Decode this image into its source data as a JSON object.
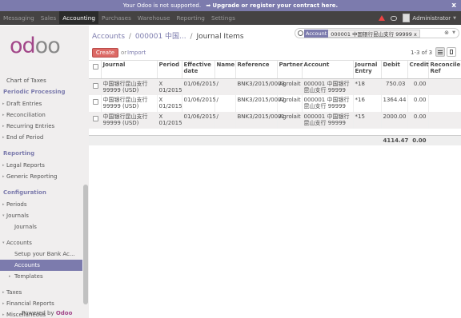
{
  "announcement": {
    "text": "Your Odoo is not supported.",
    "link": "Upgrade or register your contract here.",
    "close": "x"
  },
  "topbar": {
    "menu": [
      "Messaging",
      "Sales",
      "Accounting",
      "Purchases",
      "Warehouse",
      "Reporting",
      "Settings"
    ],
    "active": "Accounting",
    "user": "Administrator"
  },
  "logo": {
    "text_main": "od",
    "text_accent": "oo"
  },
  "sidebar": {
    "top_items": [
      "Chart of Taxes"
    ],
    "periodic": {
      "title": "Periodic Processing",
      "items": [
        "Draft Entries",
        "Reconciliation",
        "Recurring Entries",
        "End of Period"
      ]
    },
    "reporting": {
      "title": "Reporting",
      "items": [
        "Legal Reports",
        "Generic Reporting"
      ]
    },
    "configuration": {
      "title": "Configuration",
      "periods": "Periods",
      "journals": "Journals",
      "journals_sub": "Journals",
      "accounts": "Accounts",
      "setup_bank": "Setup your Bank Ac...",
      "accounts_sub": "Accounts",
      "templates": "Templates",
      "taxes": "Taxes",
      "financial_reports": "Financial Reports",
      "miscellaneous": "Miscellaneous"
    },
    "powered_by": "Powered by",
    "powered_brand": "Odoo"
  },
  "breadcrumb": {
    "root": "Accounts",
    "mid": "000001 中国...",
    "current": "Journal Items"
  },
  "search": {
    "facet_key": "Account",
    "facet_value": "000001 中国银行昆山支行 99999",
    "facet_remove": "x"
  },
  "toolbar": {
    "create": "Create",
    "or": "or",
    "import": "Import",
    "pager": "1-3 of 3"
  },
  "table": {
    "columns": [
      "Journal",
      "Period",
      "Effective date",
      "Name",
      "Reference",
      "Partner",
      "Account",
      "Journal Entry",
      "Debit",
      "Credit",
      "Reconcile Ref"
    ],
    "rows": [
      {
        "journal": "中国银行昆山支行 99999 (USD)",
        "period": "X 01/2015",
        "date": "01/06/2015",
        "name": "/",
        "reference": "BNK3/2015/0003",
        "partner": "Agrolait",
        "account": "000001 中国银行昆山支行 99999",
        "entry": "*18",
        "debit": "750.03",
        "credit": "0.00",
        "reconcile": ""
      },
      {
        "journal": "中国银行昆山支行 99999 (USD)",
        "period": "X 01/2015",
        "date": "01/06/2015",
        "name": "/",
        "reference": "BNK3/2015/0002",
        "partner": "Agrolait",
        "account": "000001 中国银行昆山支行 99999",
        "entry": "*16",
        "debit": "1364.44",
        "credit": "0.00",
        "reconcile": ""
      },
      {
        "journal": "中国银行昆山支行 99999 (USD)",
        "period": "X 01/2015",
        "date": "01/06/2015",
        "name": "/",
        "reference": "BNK3/2015/0001",
        "partner": "Agrolait",
        "account": "000001 中国银行昆山支行 99999",
        "entry": "*15",
        "debit": "2000.00",
        "credit": "0.00",
        "reconcile": ""
      }
    ],
    "total_debit": "4114.47",
    "total_credit": "0.00"
  }
}
